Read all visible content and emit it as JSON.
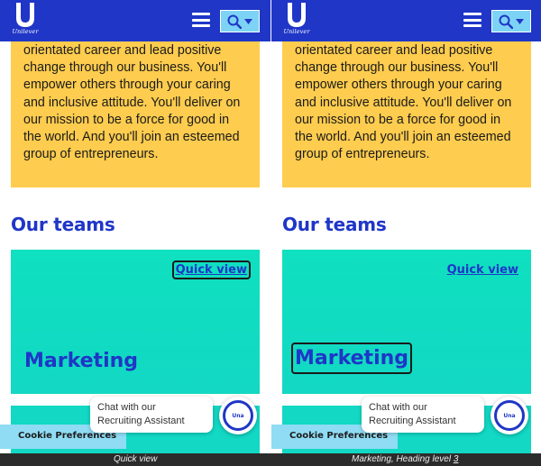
{
  "header": {
    "logo_text": "Unilever",
    "menu_icon": "hamburger-menu-icon",
    "search_icon": "search-icon",
    "search_caret_icon": "caret-down-icon"
  },
  "promo": {
    "text": "orientated career and lead positive change through our business. You'll empower others through your caring and inclusive attitude. You'll deliver on our mission to be a force for good in the world. And you'll join an esteemed group of entrepreneurs."
  },
  "teams": {
    "heading": "Our teams",
    "card": {
      "quick_view_label": "Quick view",
      "title": "Marketing"
    }
  },
  "cookie": {
    "label": "Cookie Preferences"
  },
  "chat": {
    "line1": "Chat with our",
    "line2": "Recruiting Assistant",
    "avatar_label": "Una"
  },
  "status": {
    "left": "Quick view",
    "right_prefix": "Marketing, Heading level ",
    "right_level": "3"
  },
  "colors": {
    "brand_blue": "#1f36c7",
    "promo_yellow": "#fecc4e",
    "card_teal": "#12d8c4",
    "search_bg": "#7dd3f5",
    "cookie_bg": "#8fdcf4"
  }
}
